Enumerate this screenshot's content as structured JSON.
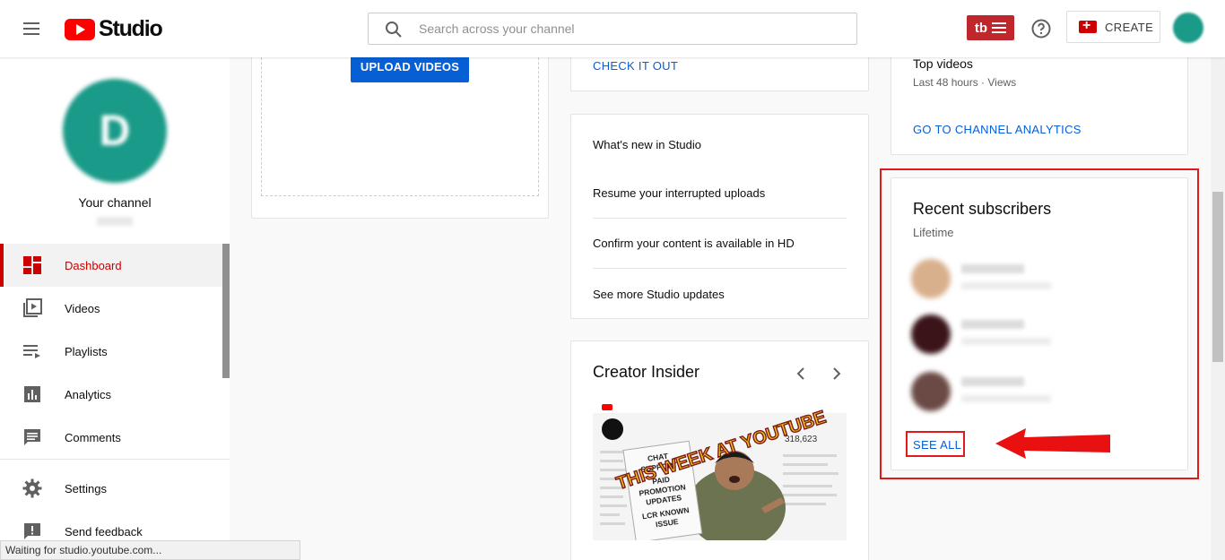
{
  "header": {
    "logo_text": "Studio",
    "search_placeholder": "Search across your channel",
    "tubebuddy_label": "tb",
    "create_label": "CREATE"
  },
  "sidebar": {
    "channel_title": "Your channel",
    "channel_initial": "D",
    "items": [
      {
        "label": "Dashboard",
        "icon": "dashboard-icon",
        "active": true
      },
      {
        "label": "Videos",
        "icon": "videos-icon"
      },
      {
        "label": "Playlists",
        "icon": "playlists-icon"
      },
      {
        "label": "Analytics",
        "icon": "analytics-icon"
      },
      {
        "label": "Comments",
        "icon": "comments-icon"
      },
      {
        "label": "Settings",
        "icon": "gear-icon"
      },
      {
        "label": "Send feedback",
        "icon": "feedback-icon"
      }
    ]
  },
  "upload_card": {
    "button_label": "UPLOAD VIDEOS"
  },
  "news_card": {
    "link_label": "CHECK IT OUT"
  },
  "whats_new": {
    "title": "What's new in Studio",
    "items": [
      "Resume your interrupted uploads",
      "Confirm your content is available in HD",
      "See more Studio updates"
    ]
  },
  "creator_insider": {
    "title": "Creator Insider",
    "thumbnail": {
      "headline": "THIS WEEK AT YOUTUBE",
      "sign_lines": [
        "CHAT",
        "SUPPORT",
        "PAID",
        "PROMOTION",
        "UPDATES",
        "LCR KNOWN",
        "ISSUE"
      ],
      "stat": "318,623"
    }
  },
  "analytics_card": {
    "top_videos_title": "Top videos",
    "top_videos_sub": "Last 48 hours · Views",
    "link_label": "GO TO CHANNEL ANALYTICS"
  },
  "recent_subscribers": {
    "title": "Recent subscribers",
    "subtitle": "Lifetime",
    "see_all_label": "SEE ALL",
    "avatar_colors": [
      "#d9b08c",
      "#3a1418",
      "#6b4a45"
    ]
  },
  "status_bar": {
    "text": "Waiting for studio.youtube.com..."
  },
  "colors": {
    "accent_red": "#cc0000",
    "link_blue": "#065fd4",
    "annotation_red": "#e01a1a"
  }
}
